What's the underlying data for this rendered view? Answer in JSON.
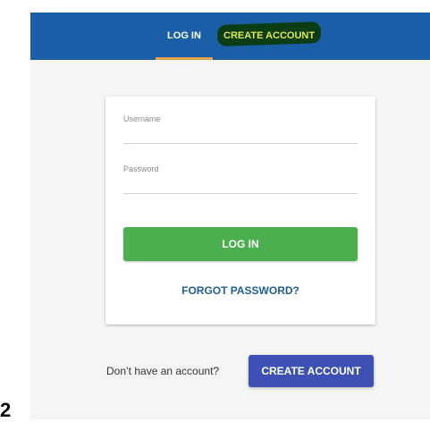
{
  "header": {
    "tabs": [
      {
        "label": "LOG IN",
        "active": true
      },
      {
        "label": "CREATE ACCOUNT",
        "active": false
      }
    ],
    "highlight_color": "#0b3d14"
  },
  "login_form": {
    "username_label": "Username",
    "password_label": "Password",
    "login_button": "LOG IN",
    "forgot_password": "FORGOT PASSWORD?"
  },
  "footer": {
    "prompt": "Don’t have an account?",
    "create_button": "CREATE ACCOUNT"
  },
  "figure_number": "2",
  "colors": {
    "header_bg": "#1a5ea8",
    "active_tab_underline": "#e0a14a",
    "login_button": "#4bae4f",
    "create_button": "#3d51b5",
    "forgot_link": "#1f5f95"
  }
}
